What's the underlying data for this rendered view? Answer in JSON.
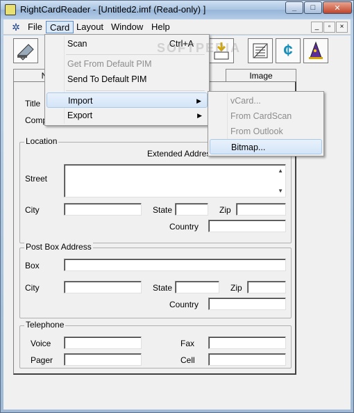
{
  "window": {
    "title": "RightCardReader - [Untitled2.imf (Read-only) ]"
  },
  "menubar": {
    "items": [
      "File",
      "Card",
      "Layout",
      "Window",
      "Help"
    ],
    "mdi": [
      "_",
      "▫",
      "×"
    ]
  },
  "watermark": "SOFTPEDIA",
  "tabs": {
    "first": "N",
    "image": "Image"
  },
  "card_menu": {
    "scan": "Scan",
    "scan_shortcut": "Ctrl+A",
    "get_pim": "Get From Default PIM",
    "send_pim": "Send To Default PIM",
    "import": "Import",
    "export": "Export"
  },
  "import_menu": [
    "vCard...",
    "From CardScan",
    "From Outlook",
    "Bitmap..."
  ],
  "form": {
    "title_label": "Title",
    "company_label": "Compa",
    "location": {
      "legend": "Location",
      "extended": "Extended Address",
      "street": "Street",
      "city": "City",
      "state": "State",
      "zip": "Zip",
      "country": "Country"
    },
    "postbox": {
      "legend": "Post Box Address",
      "box": "Box",
      "city": "City",
      "state": "State",
      "zip": "Zip",
      "country": "Country"
    },
    "telephone": {
      "legend": "Telephone",
      "voice": "Voice",
      "fax": "Fax",
      "pager": "Pager",
      "cell": "Cell"
    }
  },
  "colors": {
    "highlight": "#dbe8f8",
    "disabled": "#8c8c8c"
  }
}
